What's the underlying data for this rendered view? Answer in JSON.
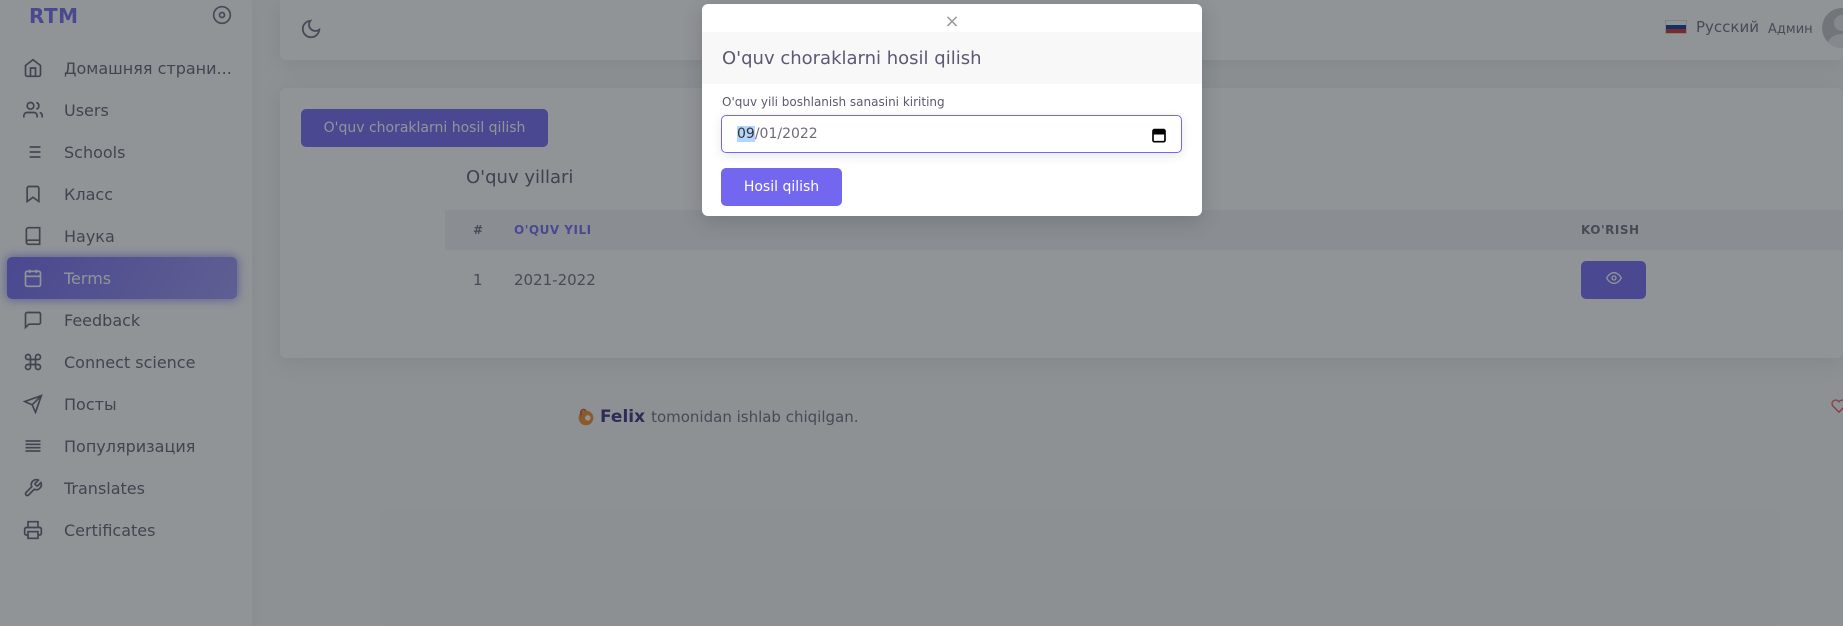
{
  "sidebar": {
    "brand": "RTM",
    "items": [
      {
        "label": "Домашняя страни...",
        "icon": "home-icon"
      },
      {
        "label": "Users",
        "icon": "users-icon"
      },
      {
        "label": "Schools",
        "icon": "list-icon"
      },
      {
        "label": "Класс",
        "icon": "bookmark-icon"
      },
      {
        "label": "Наука",
        "icon": "book-icon"
      },
      {
        "label": "Terms",
        "icon": "calendar-icon",
        "active": true
      },
      {
        "label": "Feedback",
        "icon": "message-icon"
      },
      {
        "label": "Connect science",
        "icon": "command-icon"
      },
      {
        "label": "Посты",
        "icon": "send-icon"
      },
      {
        "label": "Популяризация",
        "icon": "align-justify-icon"
      },
      {
        "label": "Translates",
        "icon": "tool-icon"
      },
      {
        "label": "Certificates",
        "icon": "printer-icon"
      }
    ]
  },
  "header": {
    "language": "Русский",
    "user": "Админ"
  },
  "main": {
    "generate_button": "O'quv choraklarni hosil qilish",
    "title": "O'quv yillari",
    "table": {
      "headers": [
        "#",
        "O'QUV YILI",
        "KO'RISH"
      ],
      "rows": [
        {
          "num": "1",
          "year": "2021-2022"
        }
      ]
    }
  },
  "footer": {
    "brand": "Felix",
    "text": "tomonidan ishlab chiqilgan."
  },
  "modal": {
    "close": "×",
    "title": "O'quv choraklarni hosil qilish",
    "field_label": "O'quv yili boshlanish sanasini kiriting",
    "date_selected": "09",
    "date_rest": "/01/2022",
    "submit": "Hosil qilish"
  },
  "colors": {
    "primary": "#7367f0",
    "overlay": "rgba(34,41,47,0.5)"
  }
}
